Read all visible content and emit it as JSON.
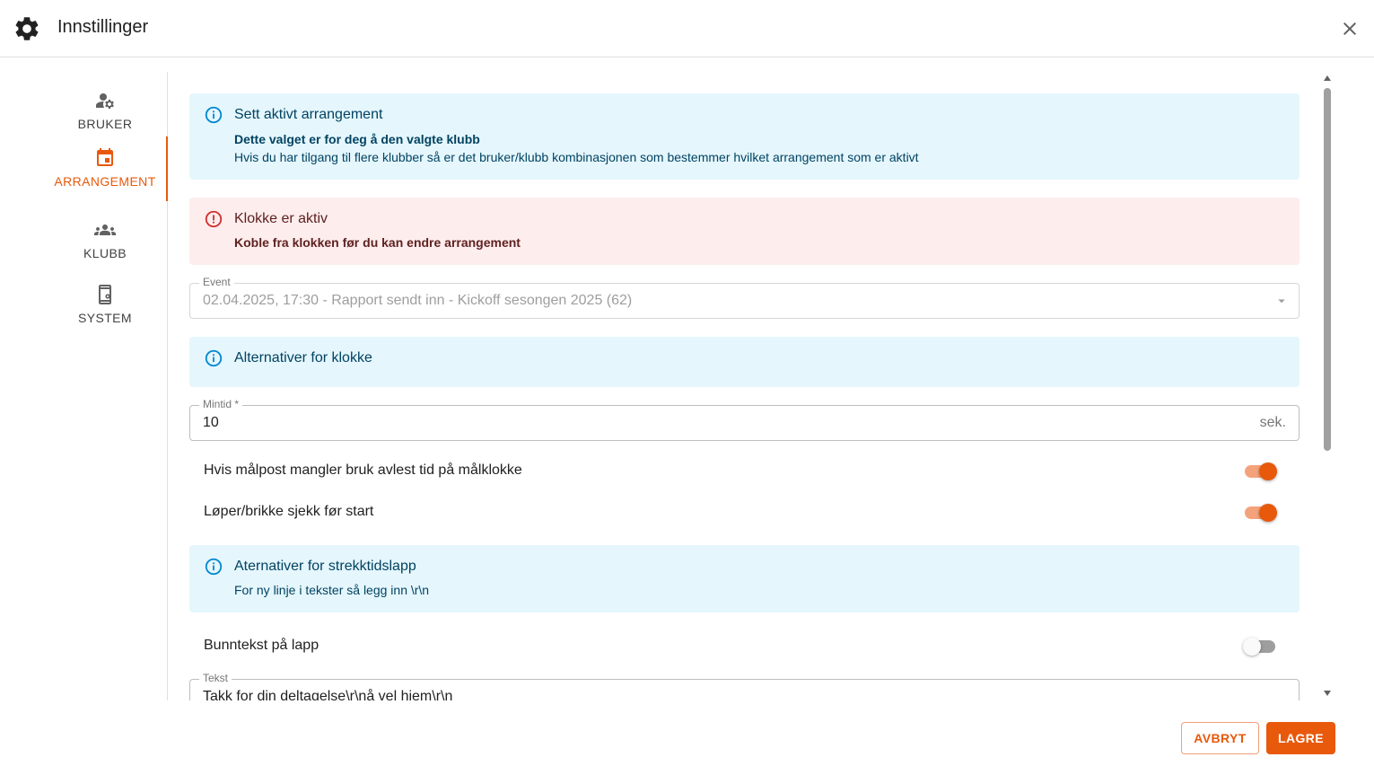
{
  "dialog": {
    "title": "Innstillinger",
    "icon": "gear-icon",
    "close_icon": "close-icon"
  },
  "sidebar": {
    "items": [
      {
        "label": "BRUKER",
        "icon": "user-settings-icon",
        "active": false
      },
      {
        "label": "ARRANGEMENT",
        "icon": "calendar-icon",
        "active": true
      },
      {
        "label": "KLUBB",
        "icon": "group-icon",
        "active": false
      },
      {
        "label": "SYSTEM",
        "icon": "device-settings-icon",
        "active": false
      }
    ],
    "active_color": "#e8590c"
  },
  "content": {
    "alert_active_event": {
      "title": "Sett aktivt arrangement",
      "line1": "Dette valget er for deg å den valgte klubb",
      "line2": "Hvis du har tilgang til flere klubber så er det bruker/klubb kombinasjonen som bestemmer hvilket arrangement som er aktivt"
    },
    "alert_clock": {
      "title": "Klokke er aktiv",
      "line1": "Koble fra klokken før du kan endre arrangement"
    },
    "event_select": {
      "label": "Event",
      "value": "02.04.2025, 17:30 - Rapport sendt inn - Kickoff sesongen 2025 (62)"
    },
    "alert_clock_options": {
      "title": "Alternativer for klokke"
    },
    "mintid_field": {
      "label": "Mintid *",
      "value": "10",
      "unit": "sek."
    },
    "switches": [
      {
        "label": "Hvis målpost mangler bruk avlest tid på målklokke",
        "on": true
      },
      {
        "label": "Løper/brikke sjekk før start",
        "on": true
      }
    ],
    "alert_split_options": {
      "title": "Aternativer for strekktidslapp",
      "line1": "For ny linje i tekster så legg inn \\r\\n"
    },
    "footer_switch": {
      "label": "Bunntekst på lapp",
      "on": false
    },
    "text_field": {
      "label": "Tekst",
      "value": "Takk for din deltagelse\\r\\nå vel hjem\\r\\n"
    }
  },
  "actions": {
    "cancel_label": "AVBRYT",
    "save_label": "LAGRE"
  },
  "colors": {
    "accent": "#e8590c",
    "info_bg": "#e5f6fd",
    "error_bg": "#fdeded",
    "info_icon": "#0288d1",
    "error_icon": "#d32f2f"
  }
}
